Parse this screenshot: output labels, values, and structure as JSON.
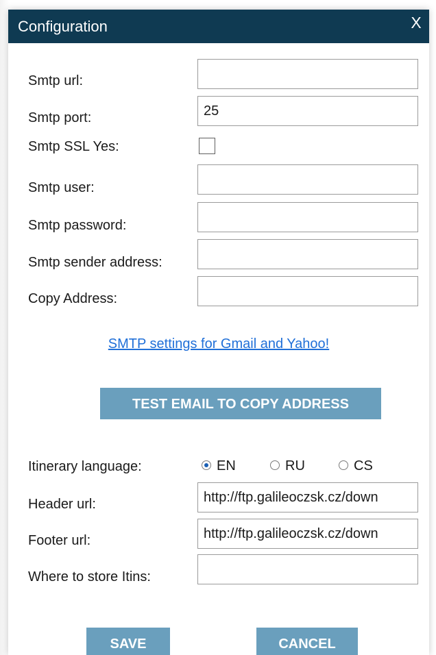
{
  "window": {
    "title": "Configuration",
    "close_label": "X"
  },
  "smtp": {
    "url_label": "Smtp url:",
    "url_value": "",
    "port_label": "Smtp port:",
    "port_value": "25",
    "ssl_label": "Smtp SSL Yes:",
    "ssl_checked": false,
    "user_label": "Smtp user:",
    "user_value": "",
    "password_label": "Smtp password:",
    "password_value": "",
    "sender_label": "Smtp sender address:",
    "sender_value": "",
    "copy_label": "Copy Address:",
    "copy_value": ""
  },
  "help_link": "SMTP settings for Gmail and Yahoo!",
  "test_button": "TEST EMAIL TO COPY ADDRESS",
  "itinerary": {
    "language_label": "Itinerary language:",
    "languages": [
      {
        "label": "EN",
        "selected": true
      },
      {
        "label": "RU",
        "selected": false
      },
      {
        "label": "CS",
        "selected": false
      }
    ],
    "header_label": "Header url:",
    "header_value": "http://ftp.galileoczsk.cz/down",
    "footer_label": "Footer url:",
    "footer_value": "http://ftp.galileoczsk.cz/down",
    "store_label": "Where to store Itins:",
    "store_value": ""
  },
  "footer": {
    "save": "SAVE",
    "cancel": "CANCEL"
  },
  "colors": {
    "titlebar": "#0f3a52",
    "button": "#6a9fbd",
    "link": "#1f6fd8"
  }
}
